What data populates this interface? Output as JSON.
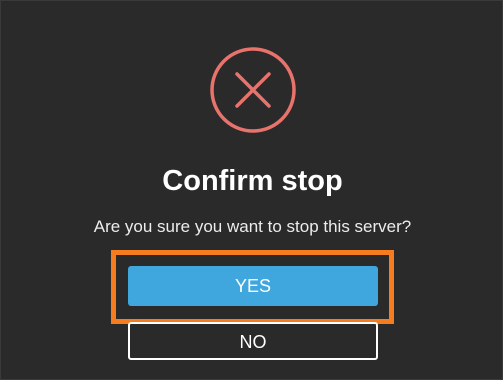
{
  "dialog": {
    "icon": "close-circle-icon",
    "icon_color": "#e8736c",
    "title": "Confirm stop",
    "message": "Are you sure you want to stop this server?",
    "highlight_color": "#f57c1f"
  },
  "buttons": {
    "yes_label": "YES",
    "no_label": "NO",
    "yes_color": "#3fa6de"
  }
}
